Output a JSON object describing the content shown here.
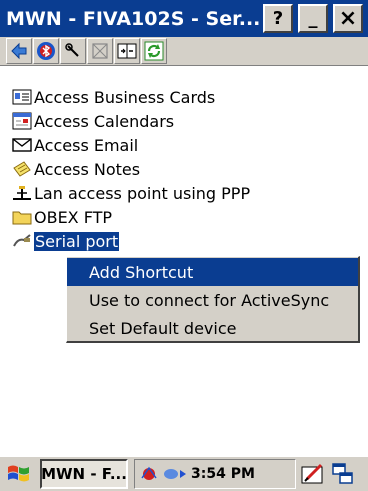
{
  "window": {
    "title": "MWN - FIVA102S - Ser...",
    "help_label": "?",
    "minimize_label": "_",
    "close_label": "×"
  },
  "toolbar": {
    "tools": [
      {
        "icon": "back-arrow-icon"
      },
      {
        "icon": "bluetooth-icon"
      },
      {
        "icon": "wrench-icon"
      },
      {
        "icon": "disabled-box-icon"
      },
      {
        "icon": "split-view-icon"
      },
      {
        "icon": "refresh-icon"
      }
    ]
  },
  "services": [
    {
      "label": "Access Business Cards",
      "icon": "business-card-icon"
    },
    {
      "label": "Access Calendars",
      "icon": "calendar-icon"
    },
    {
      "label": "Access Email",
      "icon": "envelope-icon"
    },
    {
      "label": "Access Notes",
      "icon": "notes-icon"
    },
    {
      "label": "Lan access point using PPP",
      "icon": "lan-access-icon"
    },
    {
      "label": "OBEX FTP",
      "icon": "folder-icon"
    },
    {
      "label": "Serial port",
      "icon": "serial-port-icon",
      "selected": true
    }
  ],
  "context_menu": {
    "items": [
      {
        "label": "Add Shortcut",
        "highlighted": true
      },
      {
        "label": "Use to connect for ActiveSync"
      },
      {
        "label": "Set Default device"
      }
    ]
  },
  "taskbar": {
    "task_label": "MWN - F...",
    "clock": "3:54 PM"
  },
  "colors": {
    "titlebar": "#0a3d91",
    "selection": "#0a3d91",
    "chrome": "#d4d0c8"
  }
}
